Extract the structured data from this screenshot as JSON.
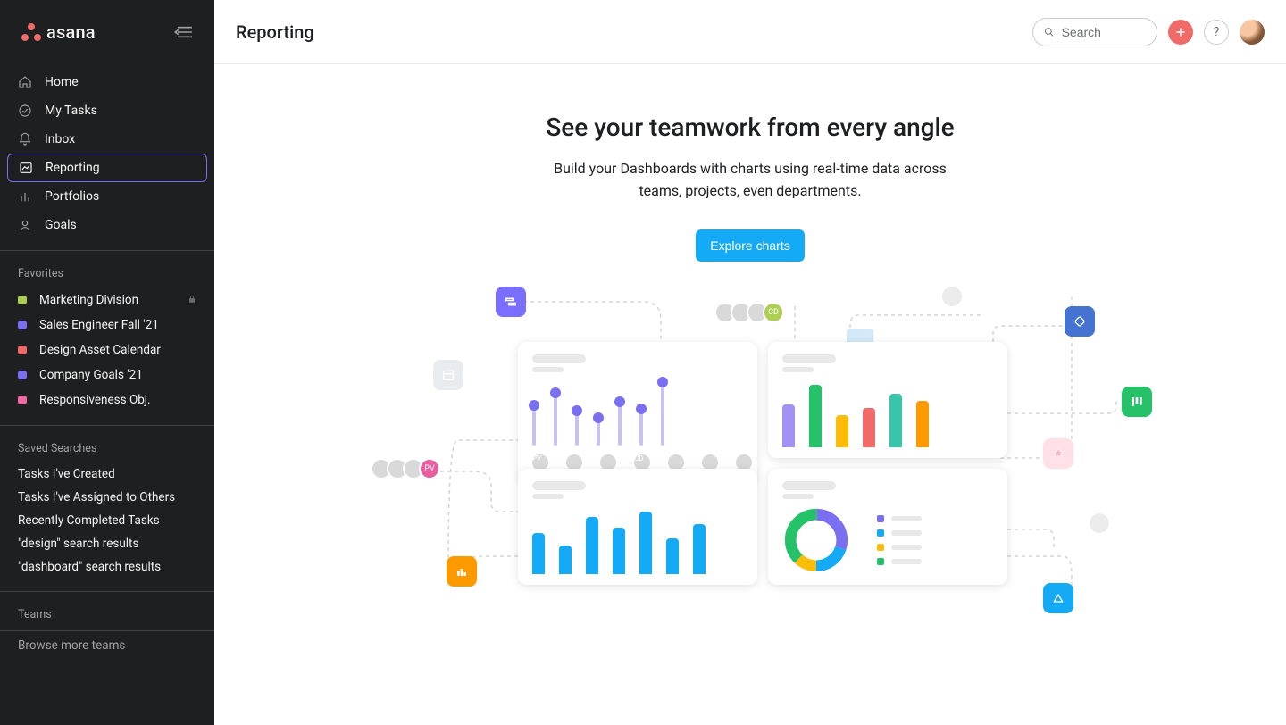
{
  "brand": "asana",
  "page_title": "Reporting",
  "search_placeholder": "Search",
  "nav": [
    {
      "label": "Home"
    },
    {
      "label": "My Tasks"
    },
    {
      "label": "Inbox"
    },
    {
      "label": "Reporting"
    },
    {
      "label": "Portfolios"
    },
    {
      "label": "Goals"
    }
  ],
  "favorites_header": "Favorites",
  "favorites": [
    {
      "label": "Marketing Division",
      "color": "#aecf55",
      "locked": true
    },
    {
      "label": "Sales Engineer Fall '21",
      "color": "#7a6ff0"
    },
    {
      "label": "Design Asset Calendar",
      "color": "#f06a6a"
    },
    {
      "label": "Company Goals '21",
      "color": "#7a6ff0"
    },
    {
      "label": "Responsiveness Obj.",
      "color": "#f06aa0"
    }
  ],
  "saved_header": "Saved Searches",
  "saved_searches": [
    "Tasks I've Created",
    "Tasks I've Assigned to Others",
    "Recently Completed Tasks",
    "\"design\" search results",
    "\"dashboard\" search results"
  ],
  "teams_header": "Teams",
  "browse_teams": "Browse more teams",
  "hero": {
    "headline": "See your teamwork from every angle",
    "subtext": "Build your Dashboards with charts using real-time data across teams, projects, even departments.",
    "cta": "Explore charts"
  },
  "colors": {
    "accent_blue": "#14aaf5",
    "purple": "#7a6ff0",
    "green": "#25c269",
    "yellow": "#fbbd08",
    "red": "#f06a6a",
    "orange": "#fd9a00",
    "teal": "#37c5ab",
    "pink": "#e85fa0"
  }
}
